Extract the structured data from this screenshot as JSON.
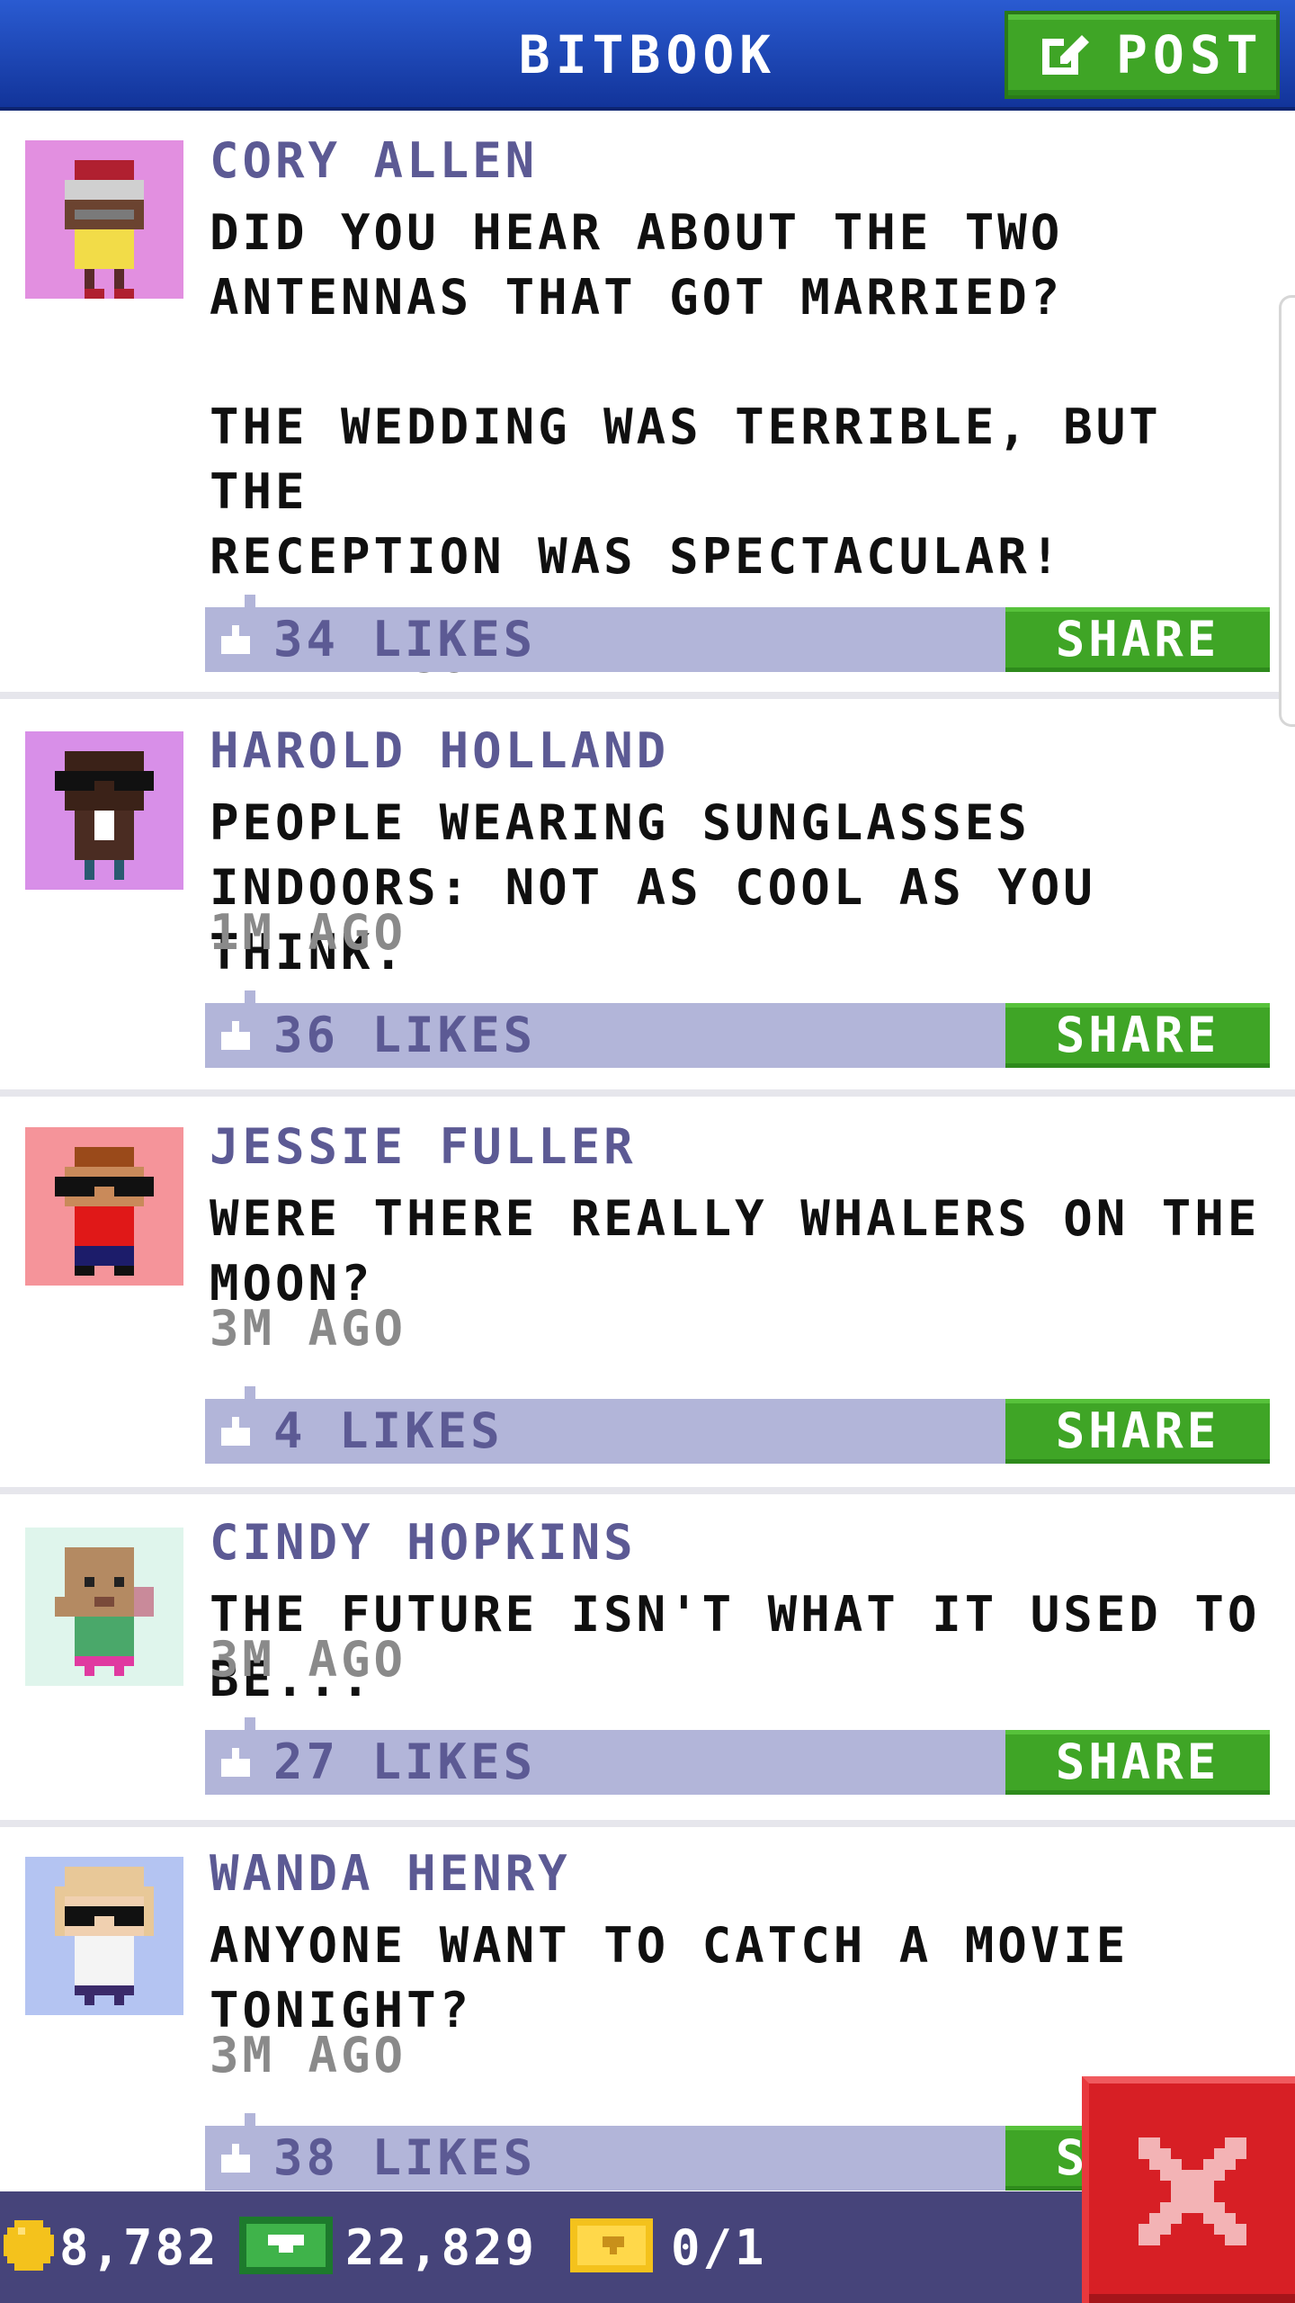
{
  "header": {
    "title": "BITBOOK",
    "post_button_label": "POST"
  },
  "colors": {
    "header_blue": "#1e46b8",
    "accent_green": "#3fa526",
    "like_bar": "#b2b5d9",
    "name_purple": "#5c5a94",
    "status_bar": "#46447a",
    "close_red": "#d71f25"
  },
  "posts": [
    {
      "avatar_bg": "#e28fe0",
      "name": "CORY ALLEN",
      "text": "DID YOU HEAR ABOUT THE TWO\nANTENNAS THAT GOT MARRIED?\n\nTHE WEDDING WAS TERRIBLE, BUT THE\nRECEPTION WAS SPECTACULAR!",
      "time": "< 1M AGO",
      "likes": "34 LIKES",
      "share_label": "SHARE"
    },
    {
      "avatar_bg": "#d88fe8",
      "name": "HAROLD HOLLAND",
      "text": "PEOPLE WEARING SUNGLASSES\nINDOORS: NOT AS COOL AS YOU THINK.",
      "time": "1M AGO",
      "likes": "36 LIKES",
      "share_label": "SHARE"
    },
    {
      "avatar_bg": "#f5949a",
      "name": "JESSIE FULLER",
      "text": "WERE THERE REALLY WHALERS ON THE\nMOON?",
      "time": "3M AGO",
      "likes": "4 LIKES",
      "share_label": "SHARE"
    },
    {
      "avatar_bg": "#dff5ec",
      "name": "CINDY HOPKINS",
      "text": "THE FUTURE ISN'T WHAT IT USED TO BE...",
      "time": "3M AGO",
      "likes": "27 LIKES",
      "share_label": "SHARE"
    },
    {
      "avatar_bg": "#b4c4f2",
      "name": "WANDA HENRY",
      "text": "ANYONE WANT TO CATCH A MOVIE\nTONIGHT?",
      "time": "3M AGO",
      "likes": "38 LIKES",
      "share_label": "SHARE"
    }
  ],
  "status": {
    "coins": "8,782",
    "bux": "22,829",
    "tickets": "0/1"
  },
  "icons": {
    "post": "edit-icon",
    "like": "thumbs-up-icon",
    "coin": "coin-icon",
    "bux": "bux-icon",
    "ticket": "ticket-icon",
    "close": "close-icon"
  }
}
